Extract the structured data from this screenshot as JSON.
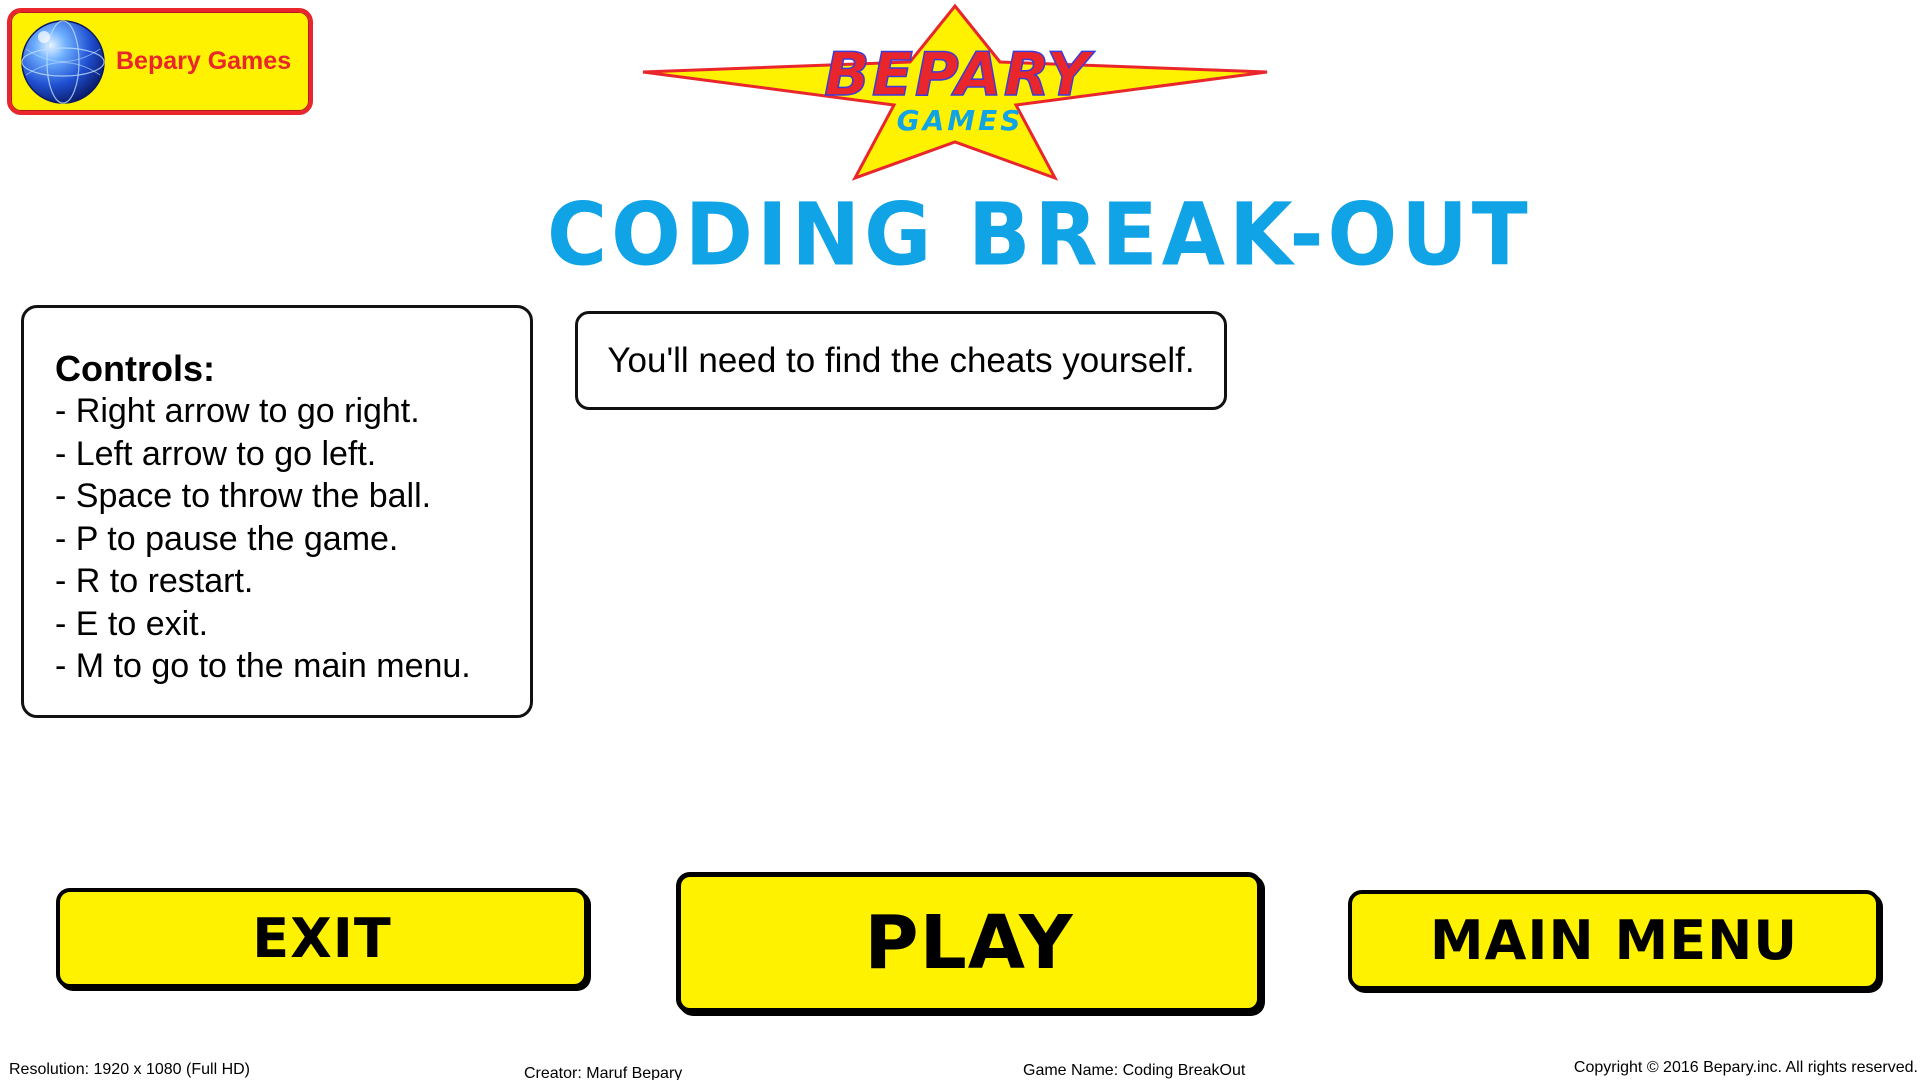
{
  "brand_badge": {
    "label": "Bepary Games",
    "icon": "globe-icon",
    "border_color": "#e8262c",
    "fill_color": "#fff200"
  },
  "logo": {
    "line1": "BEPARY",
    "line2": "GAMES",
    "star_color": "#fff200",
    "star_outline": "#e8262c",
    "line1_colors": [
      "#e8262c",
      "#3b3bdc"
    ],
    "line2_color": "#10a3e6"
  },
  "title": {
    "text": "CODING BREAK-OUT",
    "color": "#10a3e6"
  },
  "controls": {
    "heading": "Controls:",
    "items": [
      "- Right arrow to go right.",
      "- Left arrow to go left.",
      "- Space to throw the ball.",
      "- P to pause the game.",
      "- R to restart.",
      "- E to exit.",
      "- M to go to the main menu."
    ]
  },
  "cheats_note": "You'll need to find the cheats yourself.",
  "buttons": {
    "exit_label": "EXIT",
    "play_label": "PLAY",
    "main_menu_label": "MAIN MENU",
    "fill_color": "#fff200"
  },
  "footer": {
    "resolution": "Resolution: 1920 x 1080 (Full HD)",
    "creator": "Creator: Maruf Bepary",
    "game_name": "Game Name: Coding BreakOut",
    "copyright": "Copyright © 2016 Bepary.inc. All rights reserved."
  }
}
